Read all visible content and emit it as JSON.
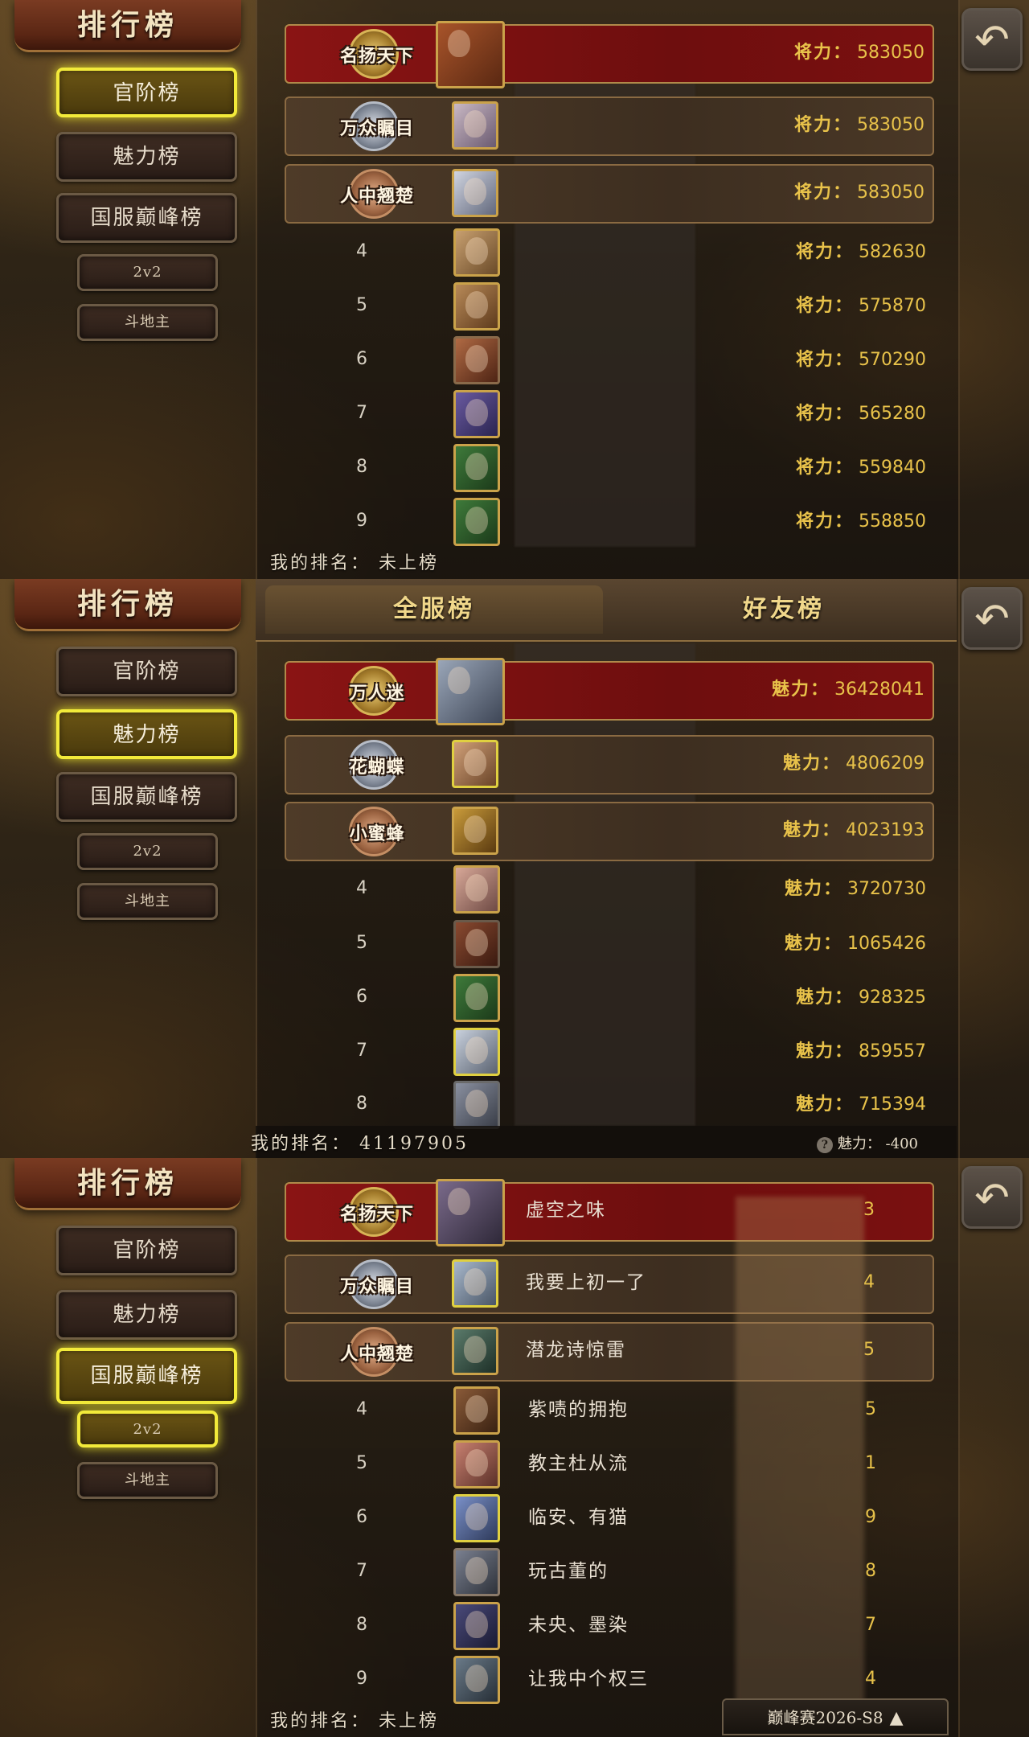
{
  "panels": [
    {
      "title": "排行榜",
      "sidebar": [
        "官阶榜",
        "魅力榜",
        "国服巅峰榜"
      ],
      "sidebar_small": [
        "2v2",
        "斗地主"
      ],
      "stat_label": "将力：",
      "rows": [
        {
          "badge": "名扬天下",
          "value": "583050"
        },
        {
          "badge": "万众瞩目",
          "value": "583050"
        },
        {
          "badge": "人中翘楚",
          "value": "583050"
        },
        {
          "rank": "4",
          "value": "582630"
        },
        {
          "rank": "5",
          "value": "575870"
        },
        {
          "rank": "6",
          "value": "570290"
        },
        {
          "rank": "7",
          "value": "565280"
        },
        {
          "rank": "8",
          "value": "559840"
        },
        {
          "rank": "9",
          "value": "558850"
        }
      ],
      "my_rank": "我的排名： 未上榜"
    },
    {
      "title": "排行榜",
      "sidebar": [
        "官阶榜",
        "魅力榜",
        "国服巅峰榜"
      ],
      "sidebar_small": [
        "2v2",
        "斗地主"
      ],
      "tabs": [
        "全服榜",
        "好友榜"
      ],
      "stat_label": "魅力：",
      "rows": [
        {
          "badge": "万人迷",
          "value": "36428041"
        },
        {
          "badge": "花蝴蝶",
          "value": "4806209"
        },
        {
          "badge": "小蜜蜂",
          "value": "4023193"
        },
        {
          "rank": "4",
          "value": "3720730"
        },
        {
          "rank": "5",
          "value": "1065426"
        },
        {
          "rank": "6",
          "value": "928325"
        },
        {
          "rank": "7",
          "value": "859557"
        },
        {
          "rank": "8",
          "value": "715394"
        }
      ],
      "my_rank": "我的排名： 41197905",
      "my_charm": "魅力： -400"
    },
    {
      "title": "排行榜",
      "sidebar": [
        "官阶榜",
        "魅力榜",
        "国服巅峰榜"
      ],
      "sidebar_small": [
        "2v2",
        "斗地主"
      ],
      "rows": [
        {
          "badge": "名扬天下",
          "name": "虚空之味",
          "tail": "3"
        },
        {
          "badge": "万众瞩目",
          "name": "我要上初一了",
          "tail": "4"
        },
        {
          "badge": "人中翘楚",
          "name": "潜龙诗惊雷",
          "tail": "5"
        },
        {
          "rank": "4",
          "name": "紫啧的拥抱",
          "tail": "5"
        },
        {
          "rank": "5",
          "name": "教主杜从流",
          "tail": "1"
        },
        {
          "rank": "6",
          "name": "临安、有猫",
          "tail": "9"
        },
        {
          "rank": "7",
          "name": "玩古董的",
          "tail": "8"
        },
        {
          "rank": "8",
          "name": "未央、墨染",
          "tail": "7"
        },
        {
          "rank": "9",
          "name": "让我中个权三",
          "tail": "4"
        }
      ],
      "my_rank": "我的排名： 未上榜",
      "season": "巅峰赛2026-S8"
    }
  ]
}
